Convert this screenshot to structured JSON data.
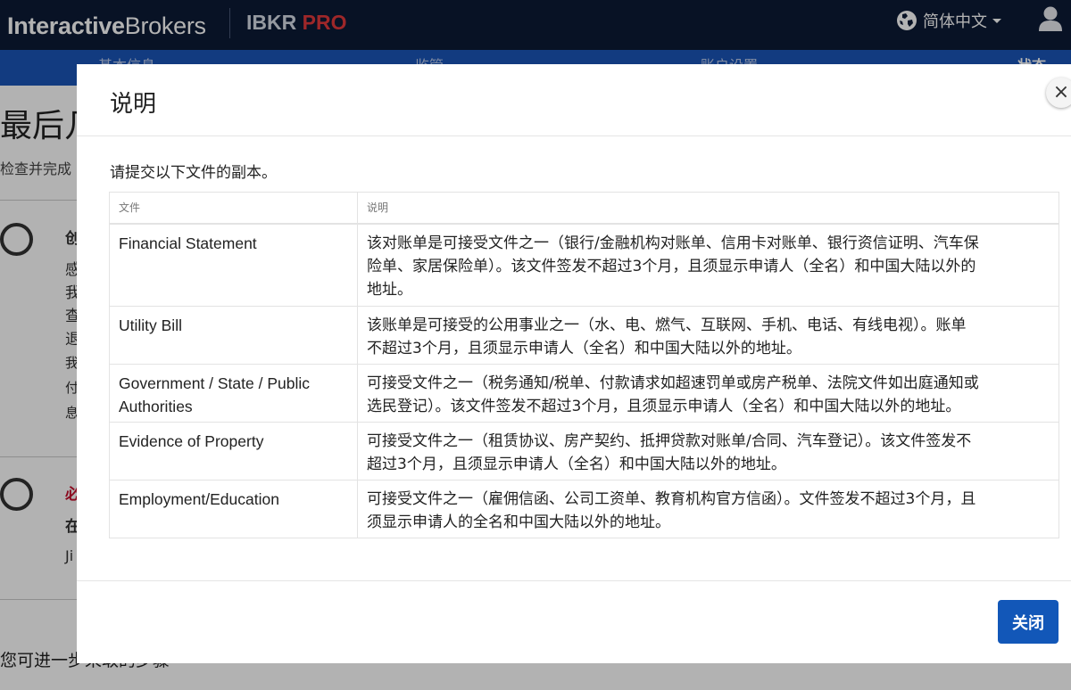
{
  "app": {
    "logo_bold": "Interactive",
    "logo_light": "Brokers",
    "product": "IBKR",
    "product_tier": "PRO",
    "language": "简体中文"
  },
  "background": {
    "steps": [
      "基本信息",
      "监管",
      "账户设置",
      "状态"
    ],
    "page_title": "最后几步",
    "page_subtitle": "检查并完成",
    "item1_chars": [
      "创",
      "感",
      "我",
      "查",
      "退",
      "我",
      "付",
      "息"
    ],
    "item2_chars": [
      "必",
      "在",
      "Ji"
    ],
    "bottom_text": "您可进一步采取的步骤"
  },
  "modal": {
    "title": "说明",
    "close_glyph": "×",
    "intro": "请提交以下文件的副本。",
    "table": {
      "headers": [
        "文件",
        "说明"
      ],
      "rows": [
        {
          "name": "Financial Statement",
          "desc_lines": [
            "该对账单是可接受文件之一（银行/金融机构对账单、信用卡对账单、银行资信证明、汽车保",
            "险单、家居保险单）。该文件签发不超过3个月，且须显示申请人（全名）和中国大陆以外的",
            "地址。"
          ]
        },
        {
          "name": "Utility Bill",
          "desc_lines": [
            "该账单是可接受的公用事业之一（水、电、燃气、互联网、手机、电话、有线电视）。账单",
            "不超过3个月，且须显示申请人（全名）和中国大陆以外的地址。"
          ]
        },
        {
          "name": "Government / State / Public Authorities",
          "desc_lines": [
            "可接受文件之一（税务通知/税单、付款请求如超速罚单或房产税单、法院文件如出庭通知或",
            "选民登记）。该文件签发不超过3个月，且须显示申请人（全名）和中国大陆以外的地址。"
          ]
        },
        {
          "name": "Evidence of Property",
          "desc_lines": [
            "可接受文件之一（租赁协议、房产契约、抵押贷款对账单/合同、汽车登记）。该文件签发不",
            "超过3个月，且须显示申请人（全名）和中国大陆以外的地址。"
          ]
        },
        {
          "name": "Employment/Education",
          "desc_lines": [
            "可接受文件之一（雇佣信函、公司工资单、教育机构官方信函）。文件签发不超过3个月，且",
            "须显示申请人的全名和中国大陆以外的地址。"
          ]
        }
      ]
    },
    "close_button": "关闭"
  },
  "colors": {
    "topbar": "#0c1a36",
    "accent_red": "#e2393c",
    "subnav": "#1b55b8",
    "primary_button": "#1257b8"
  },
  "icons": {
    "language": "globe-icon",
    "dropdown": "caret-down-icon",
    "account": "user-icon",
    "close": "close-icon"
  }
}
